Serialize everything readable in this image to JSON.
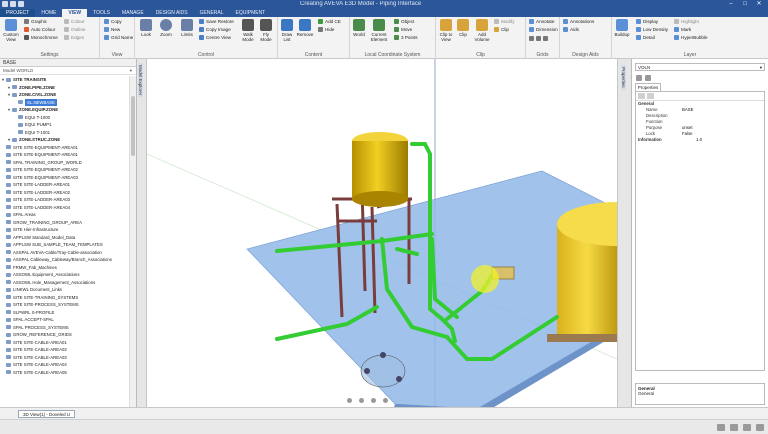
{
  "window": {
    "title": "Creating AVEVA E3D Model - Piping Interface"
  },
  "tabs": [
    "PROJECT",
    "HOME",
    "VIEW",
    "TOOLS",
    "MANAGE",
    "DESIGN AIDS",
    "GENERAL",
    "EQUIPMENT"
  ],
  "ribbon": {
    "settings": {
      "name": "Settings",
      "custom_view": "Custom View",
      "graphic": "Graphic",
      "auto_colour": "Auto Colour",
      "monochrome": "Monochrome",
      "colour": "Colour",
      "outline": "Outline",
      "edges": "Edges"
    },
    "view": {
      "name": "View",
      "copy": "Copy",
      "new": "New",
      "grid_name": "Grid Name"
    },
    "control": {
      "name": "Control",
      "look": "Look",
      "zoom": "Zoom",
      "limits": "Limits",
      "save_restore": "Save Restore",
      "copy_image": "Copy Image",
      "centre_view": "Centre View",
      "walk_mode": "Walk Mode",
      "fly_mode": "Fly Mode"
    },
    "content": {
      "name": "Content",
      "draw_list": "Draw List",
      "remove": "Remove",
      "add_ce": "Add CE",
      "hide": "Hide"
    },
    "lcs": {
      "name": "Local Coordinate System",
      "world": "World",
      "current_element": "Current Element",
      "object": "Object",
      "move": "Move",
      "3_points": "3 Points"
    },
    "clip": {
      "name": "Clip",
      "clip_to_view": "Clip to View",
      "clip": "Clip",
      "add_volume": "Add Volume",
      "modify": "Modify",
      "clip_btn": "Clip"
    },
    "grids": {
      "name": "Grids",
      "annotate": "Annotate",
      "dimension": "Dimension"
    },
    "design_aids": {
      "name": "Design Aids",
      "annotations": "Annotations",
      "aids": "Aids"
    },
    "layer": {
      "name": "Layer",
      "buildup": "Buildup",
      "display": "Display",
      "low_density": "Low Density",
      "detail": "Detail",
      "highlight": "Highlight",
      "mark": "Mark",
      "hyperbubble": "HyperBubble"
    }
  },
  "left_panel": {
    "title": "BASE",
    "subtitle": "Model WORLD",
    "tree": [
      {
        "label": "SITE TRAINSITE",
        "indent": 0,
        "bold": true
      },
      {
        "label": "ZONE.PIPE.ZONE",
        "indent": 1,
        "bold": true
      },
      {
        "label": "ZONE.CIVIL.ZONE",
        "indent": 1,
        "bold": true
      },
      {
        "label": "SL.NEWBASE",
        "indent": 2,
        "selected": true
      },
      {
        "label": "ZONE.EQUIP.ZONE",
        "indent": 1,
        "bold": true
      },
      {
        "label": "EQUI T-1000",
        "indent": 2
      },
      {
        "label": "EQUI PUMP1",
        "indent": 2
      },
      {
        "label": "EQUI T-1001",
        "indent": 2
      },
      {
        "label": "ZONE.STRUC.ZONE",
        "indent": 1,
        "bold": true
      },
      {
        "label": "SITE SITE-EQUIPMENT-AREA01",
        "indent": 0
      },
      {
        "label": "SITE SITE-EQUIPMENT-AREA01",
        "indent": 0
      },
      {
        "label": "SPAL TRAINING_GROUP_WORLD",
        "indent": 0
      },
      {
        "label": "SITE SITE-EQUIPMENT-AREA02",
        "indent": 0
      },
      {
        "label": "SITE SITE-EQUIPMENT-AREA03",
        "indent": 0
      },
      {
        "label": "SITE SITE-LADDER-AREA01",
        "indent": 0
      },
      {
        "label": "SITE SITE-LADDER-AREA02",
        "indent": 0
      },
      {
        "label": "SITE SITE-LADDER-AREA03",
        "indent": 0
      },
      {
        "label": "SITE SITE-LADDER-AREA04",
        "indent": 0
      },
      {
        "label": "SPAL Areas",
        "indent": 0
      },
      {
        "label": "GROW_TRAINING_GROUP_AREA",
        "indent": 0
      },
      {
        "label": "SITE Hier-Infrastructure",
        "indent": 0
      },
      {
        "label": "APPLSW Standard_Model_Data",
        "indent": 0
      },
      {
        "label": "APPLSW SUB_SAMPLE_TEAM_TEMPLATES",
        "indent": 0
      },
      {
        "label": "ASSPAL AVEVA-Cable/Tray-Cable-association",
        "indent": 0
      },
      {
        "label": "ASSPAL Cableway_Cableway/Branch_Associations",
        "indent": 0
      },
      {
        "label": "FRMW_Fab_Machines",
        "indent": 0
      },
      {
        "label": "ASSOWL Equipment_Associations",
        "indent": 0
      },
      {
        "label": "ASSOWL Hole_Management_Associations",
        "indent": 0
      },
      {
        "label": "LINKWL Document_Links",
        "indent": 0
      },
      {
        "label": "SITE SITE-TRAINING_SYSTEMS",
        "indent": 0
      },
      {
        "label": "SITE SITE-PROCESS_SYSTEMS",
        "indent": 0
      },
      {
        "label": "SLPWRL S-PROFILE",
        "indent": 0
      },
      {
        "label": "SPAL ACCEPT-SPAL",
        "indent": 0
      },
      {
        "label": "SPAL PROCESS_SYSTEMS",
        "indent": 0
      },
      {
        "label": "GROW_REFERENCE_GRIDS",
        "indent": 0
      },
      {
        "label": "SITE SITE-CABLE-AREA01",
        "indent": 0
      },
      {
        "label": "SITE SITE-CABLE-AREA02",
        "indent": 0
      },
      {
        "label": "SITE SITE-CABLE-AREA03",
        "indent": 0
      },
      {
        "label": "SITE SITE-CABLE-AREA04",
        "indent": 0
      },
      {
        "label": "SITE SITE-CABLE-AREA05",
        "indent": 0
      }
    ]
  },
  "side_strips": {
    "left": "Model Explorer",
    "right": "Properties"
  },
  "right_panel": {
    "dropdown": "VOLN",
    "tab": "Properties",
    "properties": [
      {
        "key": "General",
        "value": "",
        "category": true
      },
      {
        "key": "Name",
        "value": "BASE"
      },
      {
        "key": "Description",
        "value": ""
      },
      {
        "key": "Function",
        "value": ""
      },
      {
        "key": "Purpose",
        "value": "unset"
      },
      {
        "key": "Lock",
        "value": "False"
      },
      {
        "key": "Information",
        "value": "1.0",
        "category": true
      }
    ],
    "desc_title": "General",
    "desc_text": "General"
  },
  "status": {
    "tab_label": "3D View(1) - Doveled U"
  }
}
